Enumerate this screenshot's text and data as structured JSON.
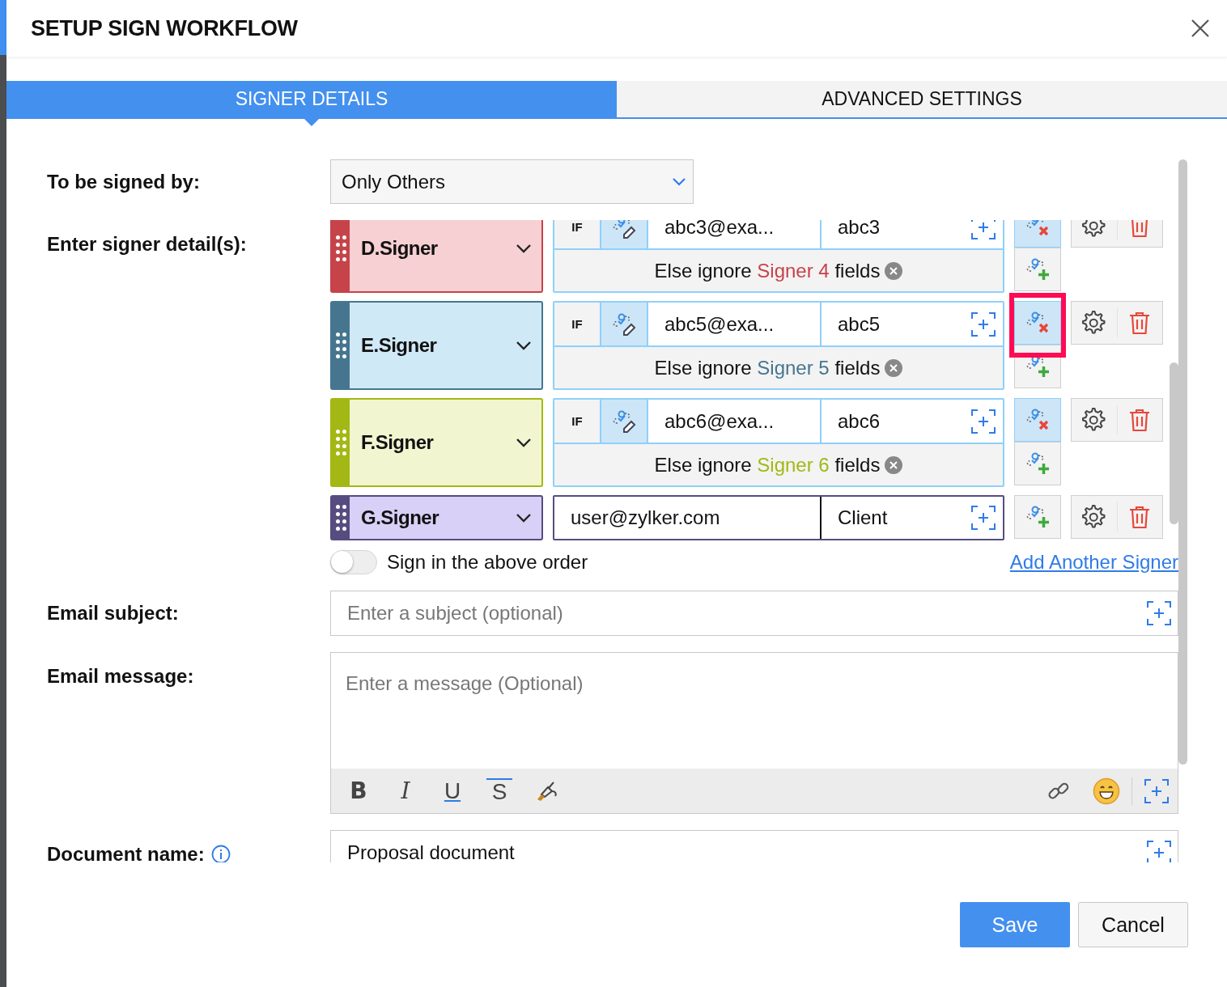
{
  "dialog": {
    "title": "SETUP SIGN WORKFLOW"
  },
  "tabs": [
    {
      "label": "SIGNER DETAILS",
      "selected": true
    },
    {
      "label": "ADVANCED SETTINGS",
      "selected": false
    }
  ],
  "signed_by": {
    "label": "To be signed by:",
    "value": "Only Others"
  },
  "signers": {
    "label": "Enter signer detail(s):",
    "items": [
      {
        "kind": "conditional",
        "name": "D.Signer",
        "color": "#c6434a",
        "condition_label": "IF",
        "email": "abc3@exa...",
        "recipient": "abc3",
        "else_prefix": "Else ignore",
        "else_signer": "Signer 4",
        "else_suffix": "fields",
        "highlighted": false
      },
      {
        "kind": "conditional",
        "name": "E.Signer",
        "color": "#46758f",
        "condition_label": "IF",
        "email": "abc5@exa...",
        "recipient": "abc5",
        "else_prefix": "Else ignore",
        "else_signer": "Signer 5",
        "else_suffix": "fields",
        "highlighted": true
      },
      {
        "kind": "conditional",
        "name": "F.Signer",
        "color": "#a3b814",
        "condition_label": "IF",
        "email": "abc6@exa...",
        "recipient": "abc6",
        "else_prefix": "Else ignore",
        "else_signer": "Signer 6",
        "else_suffix": "fields",
        "highlighted": false
      },
      {
        "kind": "plain",
        "name": "G.Signer",
        "color": "#574c7f",
        "email": "user@zylker.com",
        "recipient": "Client"
      }
    ]
  },
  "sign_order": {
    "label": "Sign in the above order",
    "on": false
  },
  "add_signer_link": "Add Another Signer",
  "email_subject": {
    "label": "Email subject:",
    "placeholder": "Enter a subject (optional)"
  },
  "email_message": {
    "label": "Email message:",
    "placeholder": "Enter a message (Optional)",
    "toolbar": [
      {
        "label": "B",
        "kind": "bold"
      },
      {
        "label": "I",
        "kind": "italic"
      },
      {
        "label": "U",
        "kind": "underline"
      },
      {
        "label": "S",
        "kind": "strike"
      }
    ]
  },
  "document_name": {
    "label": "Document name:",
    "value": "Proposal document"
  },
  "buttons": [
    {
      "label": "Save",
      "kind": "primary"
    },
    {
      "label": "Cancel",
      "kind": "secondary"
    }
  ]
}
